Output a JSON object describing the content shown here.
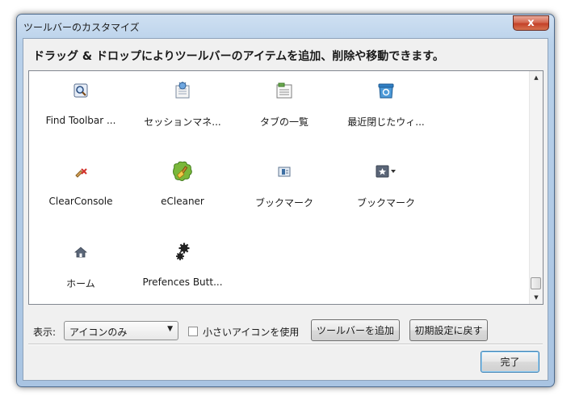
{
  "window": {
    "title": "ツールバーのカスタマイズ",
    "close_label": "x"
  },
  "heading": "ドラッグ & ドロップによりツールバーのアイテムを追加、削除や移動できます。",
  "items": [
    {
      "label": "Find Toolbar ...",
      "icon": "find-toolbar-icon"
    },
    {
      "label": "セッションマネ...",
      "icon": "session-manager-icon"
    },
    {
      "label": "タブの一覧",
      "icon": "tab-list-icon"
    },
    {
      "label": "最近閉じたウィ...",
      "icon": "recently-closed-windows-icon"
    },
    {
      "label": "ClearConsole",
      "icon": "clear-console-icon"
    },
    {
      "label": "eCleaner",
      "icon": "ecleaner-icon"
    },
    {
      "label": "ブックマーク",
      "icon": "bookmarks-icon"
    },
    {
      "label": "ブックマーク",
      "icon": "bookmarks-menu-icon"
    },
    {
      "label": "ホーム",
      "icon": "home-icon"
    },
    {
      "label": "Prefences Butt...",
      "icon": "preferences-gear-icon"
    }
  ],
  "controls": {
    "display_label": "表示:",
    "display_value": "アイコンのみ",
    "small_icons_label": "小さいアイコンを使用",
    "small_icons_checked": false,
    "add_toolbar_label": "ツールバーを追加",
    "restore_defaults_label": "初期設定に戻す",
    "done_label": "完了"
  },
  "colors": {
    "accent": "#3c7fb1",
    "frame": "#a9c4e2",
    "close": "#c44229"
  }
}
